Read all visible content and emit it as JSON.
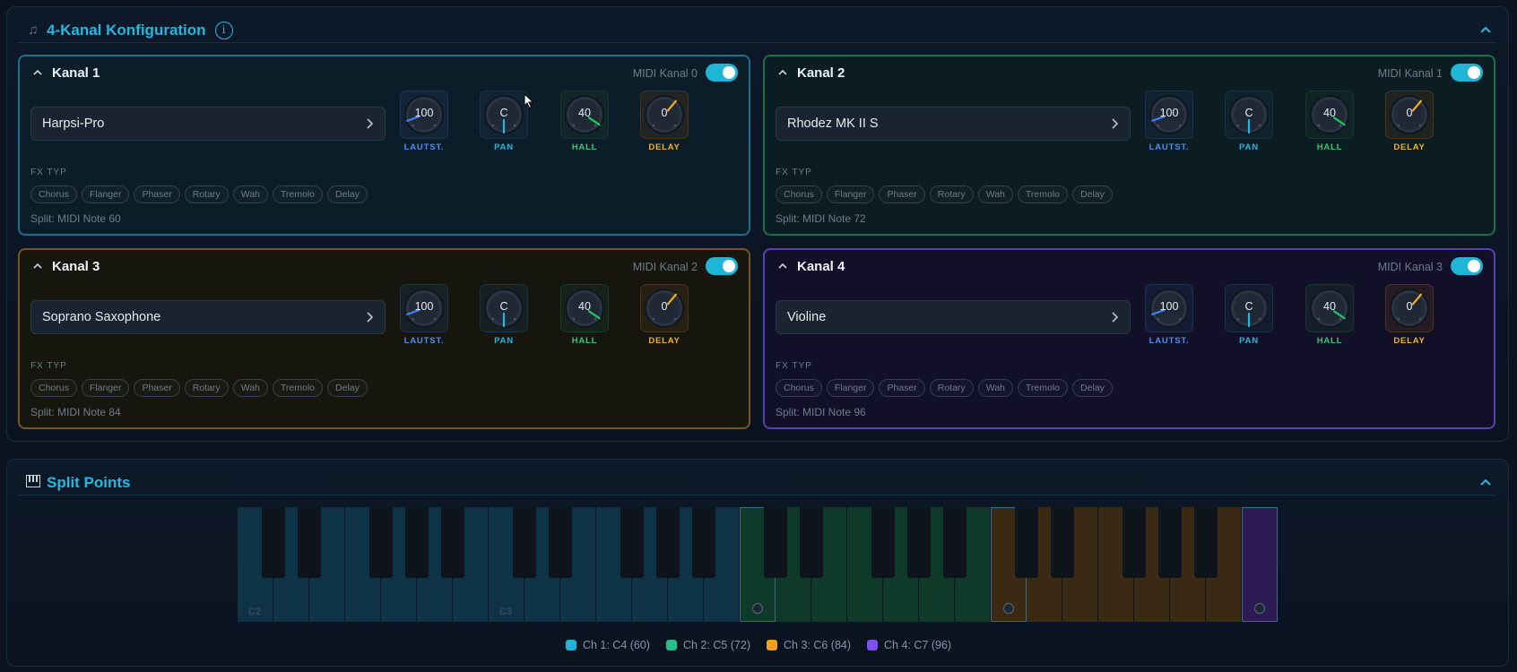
{
  "config_panel": {
    "title": "4-Kanal Konfiguration",
    "title_icon": "music-notes-icon",
    "info_label": "i",
    "fx_label": "FX TYP",
    "fx_types": [
      "Chorus",
      "Flanger",
      "Phaser",
      "Rotary",
      "Wah",
      "Tremolo",
      "Delay"
    ],
    "knob_labels": [
      "LAUTST.",
      "PAN",
      "HALL",
      "DELAY"
    ],
    "channels": [
      {
        "name": "Kanal 1",
        "midi": "MIDI Kanal 0",
        "enabled": true,
        "instrument": "Harpsi-Pro",
        "volume": "100",
        "pan": "C",
        "hall": "40",
        "delay": "0",
        "split": "Split: MIDI Note 60",
        "accent": "#22b8e0"
      },
      {
        "name": "Kanal 2",
        "midi": "MIDI Kanal 1",
        "enabled": true,
        "instrument": "Rhodez MK II S",
        "volume": "100",
        "pan": "C",
        "hall": "40",
        "delay": "0",
        "split": "Split: MIDI Note 72",
        "accent": "#22c08a"
      },
      {
        "name": "Kanal 3",
        "midi": "MIDI Kanal 2",
        "enabled": true,
        "instrument": "Soprano Saxophone",
        "volume": "100",
        "pan": "C",
        "hall": "40",
        "delay": "0",
        "split": "Split: MIDI Note 84",
        "accent": "#f59e1b"
      },
      {
        "name": "Kanal 4",
        "midi": "MIDI Kanal 3",
        "enabled": true,
        "instrument": "Violine",
        "volume": "100",
        "pan": "C",
        "hall": "40",
        "delay": "0",
        "split": "Split: MIDI Note 96",
        "accent": "#7c4ff0"
      }
    ]
  },
  "split_panel": {
    "title": "Split Points",
    "title_icon": "piano-icon",
    "octave_labels": [
      "C2",
      "C3"
    ],
    "legend": [
      {
        "label": "Ch 1: C4 (60)",
        "color": "#1fb5d6"
      },
      {
        "label": "Ch 2: C5 (72)",
        "color": "#22c08a"
      },
      {
        "label": "Ch 3: C6 (84)",
        "color": "#f59e1b"
      },
      {
        "label": "Ch 4: C7 (96)",
        "color": "#7c4ff0"
      }
    ]
  },
  "colors": {
    "knob_volume": "#3b82f6",
    "knob_pan": "#22b8e0",
    "knob_hall": "#22c55e",
    "knob_delay": "#f5b21b"
  }
}
